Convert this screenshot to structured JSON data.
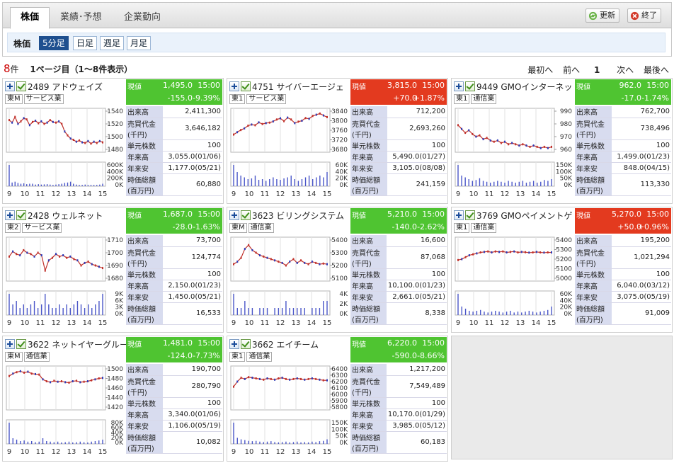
{
  "tabs": [
    "株価",
    "業績･予想",
    "企業動向"
  ],
  "buttons": {
    "refresh": "更新",
    "exit": "終了"
  },
  "sub": {
    "label": "株価",
    "periods": [
      "5分足",
      "日足",
      "週足",
      "月足"
    ]
  },
  "count": {
    "num": "8",
    "unit": "件",
    "page_info": "1ページ目（1〜8件表示）"
  },
  "pager": {
    "first": "最初へ",
    "prev": "前へ",
    "page": "1",
    "next": "次へ",
    "last": "最後へ"
  },
  "labels": {
    "price": "現値",
    "volume": "出来高",
    "turnover_1": "売買代金",
    "turnover_2": "(千円)",
    "unit": "単元株数",
    "ytd_high": "年来高",
    "ytd_low": "年来安",
    "mcap_1": "時価総額",
    "mcap_2": "(百万円)"
  },
  "x_ticks": [
    "9",
    "10",
    "11",
    "12",
    "13",
    "14",
    "15"
  ],
  "stocks": [
    {
      "name": "2489 アドウェイズ",
      "market": "東M",
      "sector": "サービス業",
      "price": "1,495.0",
      "time": "15:00",
      "change": "-155.0",
      "pct": "-9.39%",
      "dir": "down",
      "volume": "2,411,300",
      "turnover": "3,646,182",
      "unit": "100",
      "high": "3,055.0(01/06)",
      "low": "1,177.0(05/21)",
      "mcap": "60,880",
      "price_ticks": [
        "1540",
        "1520",
        "1500",
        "1480"
      ],
      "vol_ticks": [
        "600K",
        "400K",
        "200K",
        "0K"
      ],
      "chart_data": {
        "type": "line",
        "ylim": [
          1480,
          1540
        ],
        "prices": [
          1526,
          1522,
          1531,
          1520,
          1524,
          1529,
          1527,
          1518,
          1523,
          1525,
          1521,
          1524,
          1520,
          1522,
          1526,
          1523,
          1522,
          1524,
          1520,
          1508,
          1502,
          1497,
          1495,
          1492,
          1494,
          1491,
          1490,
          1493,
          1489,
          1492,
          1490,
          1493,
          1491
        ],
        "volumes": [
          520,
          90,
          110,
          80,
          60,
          70,
          50,
          60,
          60,
          40,
          50,
          40,
          45,
          50,
          40,
          30,
          40,
          50,
          60,
          80,
          90,
          110,
          60,
          40,
          30,
          30,
          40,
          30,
          30,
          30,
          30,
          40,
          60
        ]
      }
    },
    {
      "name": "4751 サイバーエージェ",
      "market": "東1",
      "sector": "サービス業",
      "price": "3,815.0",
      "time": "15:00",
      "change": "+70.0",
      "pct": "+1.87%",
      "dir": "up",
      "volume": "712,200",
      "turnover": "2,693,260",
      "unit": "100",
      "high": "5,490.0(01/27)",
      "low": "3,105.0(08/08)",
      "mcap": "241,159",
      "price_ticks": [
        "3840",
        "3800",
        "3760",
        "3720",
        "3680"
      ],
      "vol_ticks": [
        "60K",
        "40K",
        "20K",
        "0K"
      ],
      "chart_data": {
        "type": "line",
        "ylim": [
          3680,
          3840
        ],
        "prices": [
          3742,
          3752,
          3761,
          3768,
          3779,
          3784,
          3781,
          3793,
          3786,
          3790,
          3792,
          3797,
          3805,
          3810,
          3798,
          3813,
          3805,
          3790,
          3796,
          3800,
          3811,
          3808,
          3820,
          3825,
          3830,
          3822,
          3815
        ],
        "volumes": [
          60,
          40,
          30,
          25,
          20,
          22,
          30,
          18,
          20,
          15,
          20,
          25,
          20,
          18,
          22,
          25,
          30,
          20,
          15,
          20,
          25,
          30,
          20,
          25,
          30,
          25,
          40
        ]
      }
    },
    {
      "name": "9449 GMOインターネッ",
      "market": "東1",
      "sector": "通信業",
      "price": "962.0",
      "time": "15:00",
      "change": "-17.0",
      "pct": "-1.74%",
      "dir": "down",
      "volume": "762,700",
      "turnover": "738,496",
      "unit": "100",
      "high": "1,499.0(01/23)",
      "low": "848.0(04/15)",
      "mcap": "113,330",
      "price_ticks": [
        "990",
        "980",
        "970",
        "960"
      ],
      "vol_ticks": [
        "150K",
        "100K",
        "50K",
        "0K"
      ],
      "chart_data": {
        "type": "line",
        "ylim": [
          960,
          990
        ],
        "prices": [
          979,
          976,
          973,
          975,
          972,
          970,
          971,
          968,
          969,
          967,
          966,
          967,
          965,
          966,
          964,
          965,
          964,
          963,
          964,
          963,
          962,
          963,
          962,
          961,
          962,
          961,
          962
        ],
        "volumes": [
          120,
          60,
          50,
          40,
          30,
          35,
          45,
          30,
          25,
          20,
          25,
          30,
          25,
          20,
          30,
          25,
          20,
          25,
          30,
          20,
          25,
          30,
          20,
          25,
          35,
          30,
          40
        ]
      }
    },
    {
      "name": "2428 ウェルネット",
      "market": "東2",
      "sector": "サービス業",
      "price": "1,687.0",
      "time": "15:00",
      "change": "-28.0",
      "pct": "-1.63%",
      "dir": "down",
      "volume": "73,700",
      "turnover": "124,774",
      "unit": "100",
      "high": "2,150.0(01/23)",
      "low": "1,450.0(05/21)",
      "mcap": "16,533",
      "price_ticks": [
        "1710",
        "1700",
        "1690",
        "1680"
      ],
      "vol_ticks": [
        "9K",
        "6K",
        "3K",
        "0K"
      ],
      "chart_data": {
        "type": "line",
        "ylim": [
          1680,
          1710
        ],
        "prices": [
          1697,
          1701,
          1699,
          1698,
          1702,
          1700,
          1699,
          1697,
          1700,
          1698,
          1686,
          1694,
          1696,
          1699,
          1697,
          1698,
          1696,
          1697,
          1695,
          1694,
          1690,
          1692,
          1693,
          1691,
          1690,
          1689,
          1688
        ],
        "volumes": [
          6,
          3,
          4,
          2,
          3,
          2,
          3,
          4,
          2,
          3,
          6,
          3,
          2,
          2,
          3,
          2,
          3,
          2,
          3,
          4,
          3,
          2,
          3,
          2,
          3,
          4,
          6
        ]
      }
    },
    {
      "name": "3623 ビリングシステム",
      "market": "東M",
      "sector": "通信業",
      "price": "5,210.0",
      "time": "15:00",
      "change": "-140.0",
      "pct": "-2.62%",
      "dir": "down",
      "volume": "16,600",
      "turnover": "87,068",
      "unit": "100",
      "high": "10,100.0(01/23)",
      "low": "2,661.0(05/21)",
      "mcap": "8,338",
      "price_ticks": [
        "5400",
        "5300",
        "5200",
        "5100"
      ],
      "vol_ticks": [
        "4K",
        "2K",
        "0K"
      ],
      "chart_data": {
        "type": "line",
        "ylim": [
          5100,
          5400
        ],
        "prices": [
          5210,
          5230,
          5260,
          5330,
          5360,
          5320,
          5300,
          5280,
          5270,
          5260,
          5250,
          5240,
          5230,
          5220,
          5200,
          5230,
          5250,
          5220,
          5240,
          5220,
          5210,
          5230,
          5220,
          5210,
          5215,
          5210
        ],
        "volumes": [
          3,
          1,
          1,
          2,
          1,
          1,
          0,
          1,
          1,
          1,
          0,
          1,
          1,
          1,
          2,
          1,
          1,
          1,
          1,
          1,
          0,
          1,
          1,
          1,
          2,
          2
        ]
      }
    },
    {
      "name": "3769 GMOペイメントゲ",
      "market": "東1",
      "sector": "通信業",
      "price": "5,270.0",
      "time": "15:00",
      "change": "+50.0",
      "pct": "+0.96%",
      "dir": "up",
      "volume": "195,200",
      "turnover": "1,021,294",
      "unit": "100",
      "high": "6,040.0(03/12)",
      "low": "3,075.0(05/19)",
      "mcap": "91,009",
      "price_ticks": [
        "5400",
        "5300",
        "5200",
        "5100",
        "5000"
      ],
      "vol_ticks": [
        "60K",
        "40K",
        "20K",
        "0K"
      ],
      "chart_data": {
        "type": "line",
        "ylim": [
          5000,
          5400
        ],
        "prices": [
          5190,
          5200,
          5220,
          5240,
          5250,
          5260,
          5270,
          5275,
          5280,
          5270,
          5280,
          5275,
          5280,
          5270,
          5275,
          5280,
          5270,
          5275,
          5272,
          5268,
          5270,
          5275,
          5270,
          5268,
          5270,
          5270
        ],
        "volumes": [
          50,
          20,
          15,
          10,
          8,
          10,
          12,
          8,
          6,
          8,
          10,
          8,
          6,
          8,
          10,
          6,
          8,
          6,
          8,
          10,
          8,
          6,
          8,
          10,
          12,
          20
        ]
      }
    },
    {
      "name": "3622 ネットイヤーグルー",
      "market": "東M",
      "sector": "通信業",
      "price": "1,481.0",
      "time": "15:00",
      "change": "-124.0",
      "pct": "-7.73%",
      "dir": "down",
      "volume": "190,700",
      "turnover": "280,790",
      "unit": "100",
      "high": "3,340.0(01/06)",
      "low": "1,106.0(05/19)",
      "mcap": "10,082",
      "price_ticks": [
        "1500",
        "1480",
        "1460",
        "1440",
        "1420"
      ],
      "vol_ticks": [
        "80K",
        "60K",
        "40K",
        "20K",
        "0K"
      ],
      "chart_data": {
        "type": "line",
        "ylim": [
          1420,
          1500
        ],
        "prices": [
          1485,
          1490,
          1493,
          1495,
          1492,
          1494,
          1490,
          1489,
          1488,
          1478,
          1474,
          1472,
          1475,
          1473,
          1474,
          1472,
          1471,
          1474,
          1475,
          1472,
          1473,
          1474,
          1476,
          1478,
          1480,
          1481
        ],
        "volumes": [
          75,
          20,
          15,
          10,
          12,
          8,
          10,
          6,
          8,
          20,
          10,
          8,
          6,
          8,
          5,
          6,
          8,
          5,
          6,
          8,
          6,
          5,
          8,
          10,
          12,
          15
        ]
      }
    },
    {
      "name": "3662 エイチーム",
      "market": "東1",
      "sector": "通信業",
      "price": "6,220.0",
      "time": "15:00",
      "change": "-590.0",
      "pct": "-8.66%",
      "dir": "down",
      "volume": "1,217,200",
      "turnover": "7,549,489",
      "unit": "100",
      "high": "10,170.0(01/29)",
      "low": "3,985.0(05/12)",
      "mcap": "60,183",
      "price_ticks": [
        "6400",
        "6300",
        "6200",
        "6100",
        "6000",
        "5900",
        "5800"
      ],
      "vol_ticks": [
        "150K",
        "100K",
        "50K",
        "0K"
      ],
      "chart_data": {
        "type": "line",
        "ylim": [
          5800,
          6400
        ],
        "prices": [
          6120,
          6200,
          6260,
          6240,
          6270,
          6260,
          6250,
          6240,
          6230,
          6250,
          6240,
          6230,
          6250,
          6260,
          6240,
          6230,
          6240,
          6250,
          6240,
          6230,
          6240,
          6250,
          6240,
          6230,
          6220,
          6220
        ],
        "volumes": [
          140,
          40,
          30,
          25,
          20,
          18,
          20,
          15,
          12,
          15,
          18,
          12,
          10,
          12,
          15,
          10,
          12,
          15,
          10,
          12,
          10,
          15,
          12,
          18,
          20,
          30
        ]
      }
    }
  ],
  "colors": {
    "up": "#e33a1f",
    "down": "#4fc431",
    "line": "#c0312b",
    "vol": "#4a56c8",
    "accent": "#1e4f8f"
  },
  "icons": [
    "plus-icon",
    "check-icon",
    "refresh-icon",
    "exit-icon"
  ]
}
